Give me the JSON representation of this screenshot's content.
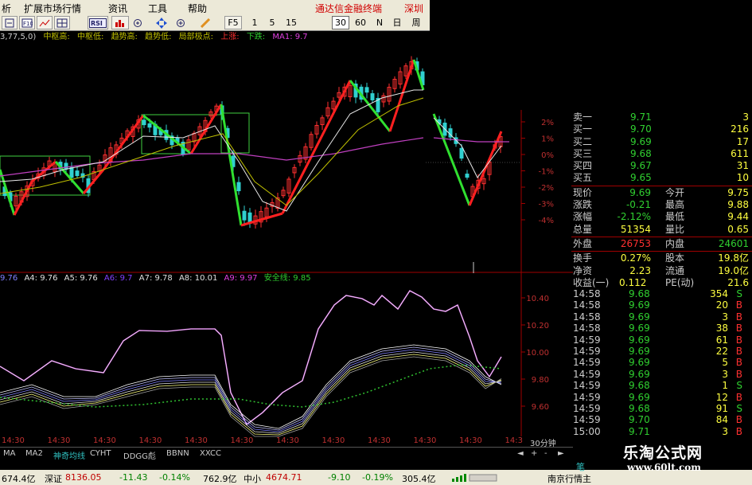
{
  "menu": {
    "items": [
      "析",
      "扩展市场行情",
      "资讯",
      "工具",
      "帮助"
    ],
    "brand": "通达信金融终端",
    "brand_right": "深圳"
  },
  "toolbar": {
    "buttons": [
      "F10",
      "RSI",
      "F5",
      "1",
      "5",
      "15",
      "30",
      "60",
      "N",
      "日",
      "周"
    ],
    "active_period": "30",
    "icons": [
      "zoom-out-icon",
      "f10-icon",
      "chart-icon",
      "grid-icon",
      "rsi-icon",
      "bar-chart-icon",
      "move-icon",
      "zoom-in-icon",
      "draw-pen-icon",
      "f5-icon"
    ]
  },
  "legend_top": {
    "params": "3,77,5,0)",
    "items": [
      {
        "text": "中枢高:",
        "color": "#c0c000"
      },
      {
        "text": "中枢低:",
        "color": "#c0c000"
      },
      {
        "text": "趋势高:",
        "color": "#c0c000"
      },
      {
        "text": "趋势低:",
        "color": "#c0c000"
      },
      {
        "text": "局部极点:",
        "color": "#c0c000"
      },
      {
        "text": "上涨:",
        "color": "#ff3030"
      },
      {
        "text": "下跌:",
        "color": "#30d030"
      },
      {
        "text": "MA1: 9.7",
        "color": "#e040e0"
      }
    ]
  },
  "legend_bottom": {
    "items": [
      {
        "text": "9.76",
        "color": "#e0e0e0"
      },
      {
        "text": "A4: 9.76",
        "color": "#e0e0e0"
      },
      {
        "text": "A5: 9.76",
        "color": "#e0e0e0"
      },
      {
        "text": "A6: 9.7",
        "color": "#8040ff"
      },
      {
        "text": "A7: 9.78",
        "color": "#e0e0e0"
      },
      {
        "text": "A8: 10.01",
        "color": "#e0e0e0"
      },
      {
        "text": "A9: 9.97",
        "color": "#e040e0"
      },
      {
        "text": "安全线: 9.85",
        "color": "#30d030"
      }
    ]
  },
  "right_axis_top": [
    "2%",
    "1%",
    "0%",
    "-1%",
    "-2%",
    "-3%",
    "-4%"
  ],
  "right_axis_bottom": [
    "10.40",
    "10.20",
    "10.00",
    "9.80",
    "9.60"
  ],
  "order_book": {
    "sell": [
      {
        "label": "卖一",
        "price": "9.71",
        "vol": "3"
      }
    ],
    "buy": [
      {
        "label": "买一",
        "price": "9.70",
        "vol": "216"
      },
      {
        "label": "买二",
        "price": "9.69",
        "vol": "17"
      },
      {
        "label": "买三",
        "price": "9.68",
        "vol": "611"
      },
      {
        "label": "买四",
        "price": "9.67",
        "vol": "31"
      },
      {
        "label": "买五",
        "price": "9.65",
        "vol": "10"
      }
    ]
  },
  "stats": [
    {
      "l1": "现价",
      "v1": "9.69",
      "c1": "#30d030",
      "l2": "今开",
      "v2": "9.75",
      "c2": "#ffff40"
    },
    {
      "l1": "涨跌",
      "v1": "-0.21",
      "c1": "#30d030",
      "l2": "最高",
      "v2": "9.88",
      "c2": "#ffff40"
    },
    {
      "l1": "涨幅",
      "v1": "-2.12%",
      "c1": "#30d030",
      "l2": "最低",
      "v2": "9.44",
      "c2": "#ffff40"
    },
    {
      "l1": "总量",
      "v1": "51354",
      "c1": "#ffff40",
      "l2": "量比",
      "v2": "0.65",
      "c2": "#ffff40"
    },
    {
      "l1": "外盘",
      "v1": "26753",
      "c1": "#ff3030",
      "l2": "内盘",
      "v2": "24601",
      "c2": "#30d030"
    },
    {
      "l1": "换手",
      "v1": "0.27%",
      "c1": "#ffff40",
      "l2": "股本",
      "v2": "19.8亿",
      "c2": "#ffff40"
    },
    {
      "l1": "净资",
      "v1": "2.23",
      "c1": "#ffff40",
      "l2": "流通",
      "v2": "19.0亿",
      "c2": "#ffff40"
    },
    {
      "l1": "收益(一)",
      "v1": "0.112",
      "c1": "#ffff40",
      "l2": "PE(动)",
      "v2": "21.6",
      "c2": "#ffff40"
    }
  ],
  "ticks": [
    {
      "time": "14:58",
      "price": "9.68",
      "vol": "354",
      "side": "S"
    },
    {
      "time": "14:58",
      "price": "9.69",
      "vol": "20",
      "side": "B"
    },
    {
      "time": "14:58",
      "price": "9.69",
      "vol": "3",
      "side": "B"
    },
    {
      "time": "14:58",
      "price": "9.69",
      "vol": "38",
      "side": "B"
    },
    {
      "time": "14:59",
      "price": "9.69",
      "vol": "61",
      "side": "B"
    },
    {
      "time": "14:59",
      "price": "9.69",
      "vol": "22",
      "side": "B"
    },
    {
      "time": "14:59",
      "price": "9.69",
      "vol": "5",
      "side": "B"
    },
    {
      "time": "14:59",
      "price": "9.69",
      "vol": "3",
      "side": "B"
    },
    {
      "time": "14:59",
      "price": "9.68",
      "vol": "1",
      "side": "S"
    },
    {
      "time": "14:59",
      "price": "9.69",
      "vol": "12",
      "side": "B"
    },
    {
      "time": "14:59",
      "price": "9.68",
      "vol": "91",
      "side": "S"
    },
    {
      "time": "14:59",
      "price": "9.70",
      "vol": "84",
      "side": "B"
    },
    {
      "time": "15:00",
      "price": "9.71",
      "vol": "3",
      "side": "B"
    },
    {
      "time": "15:00",
      "price": "",
      "vol": "",
      "side": ""
    }
  ],
  "time_axis": [
    "14:30",
    "14:30",
    "14:30",
    "14:30",
    "14:30",
    "14:30",
    "14:30",
    "14:30",
    "14:30",
    "14:30",
    "14:30",
    "14:3"
  ],
  "period_label": "30分钟",
  "indicator_tabs": [
    "MA",
    "MA2",
    "神奇均线",
    "CYHT",
    "DDGG彪",
    "BBNN",
    "XXCC"
  ],
  "active_indicator": "神奇均线",
  "tab_right_label": "笔",
  "status_bar": {
    "sh_index": "674.4亿",
    "sz_label": "深证",
    "sz_value": "8136.05",
    "sz_change": "-11.43",
    "sz_pct": "-0.14%",
    "sz_amount": "762.9亿",
    "zx_label": "中小",
    "zx_value": "4674.71",
    "zx_change": "-9.10",
    "zx_pct": "-0.19%",
    "zx_amount": "305.4亿",
    "broker": "南京行情主"
  },
  "watermark": {
    "title": "乐淘公式网",
    "url": "www.60lt.com"
  }
}
